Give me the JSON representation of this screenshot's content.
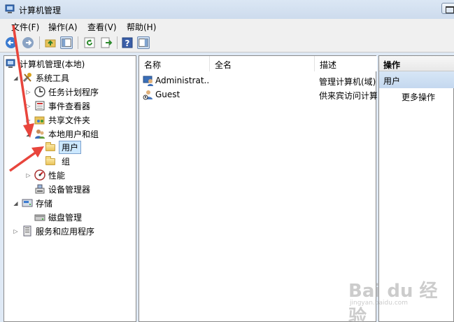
{
  "window": {
    "title": "计算机管理"
  },
  "menu": [
    "文件(F)",
    "操作(A)",
    "查看(V)",
    "帮助(H)"
  ],
  "tree": [
    {
      "label": "计算机管理(本地)",
      "icon": "computer-management-icon",
      "expander": "▲"
    },
    {
      "label": "系统工具",
      "icon": "tools-icon",
      "expander": "◢"
    },
    {
      "label": "任务计划程序",
      "icon": "clock-icon",
      "expander": "▷"
    },
    {
      "label": "事件查看器",
      "icon": "event-viewer-icon",
      "expander": "▷"
    },
    {
      "label": "共享文件夹",
      "icon": "shared-folder-icon",
      "expander": "▷"
    },
    {
      "label": "本地用户和组",
      "icon": "users-groups-icon",
      "expander": "◢"
    },
    {
      "label": "用户",
      "icon": "folder-icon",
      "expander": ""
    },
    {
      "label": "组",
      "icon": "folder-icon",
      "expander": ""
    },
    {
      "label": "性能",
      "icon": "performance-icon",
      "expander": "▷"
    },
    {
      "label": "设备管理器",
      "icon": "device-manager-icon",
      "expander": ""
    },
    {
      "label": "存储",
      "icon": "storage-icon",
      "expander": "◢"
    },
    {
      "label": "磁盘管理",
      "icon": "disk-icon",
      "expander": ""
    },
    {
      "label": "服务和应用程序",
      "icon": "services-icon",
      "expander": "▷"
    }
  ],
  "columns": [
    "名称",
    "全名",
    "描述"
  ],
  "users": [
    {
      "name": "Administrat...",
      "fullname": "",
      "desc": "管理计算机(域)"
    },
    {
      "name": "Guest",
      "fullname": "",
      "desc": "供来宾访问计算"
    }
  ],
  "actions": {
    "header": "操作",
    "section": "用户",
    "more": "更多操作"
  },
  "watermark": {
    "main": "Bai du 经验",
    "sub": "jingyan.baidu.com"
  }
}
